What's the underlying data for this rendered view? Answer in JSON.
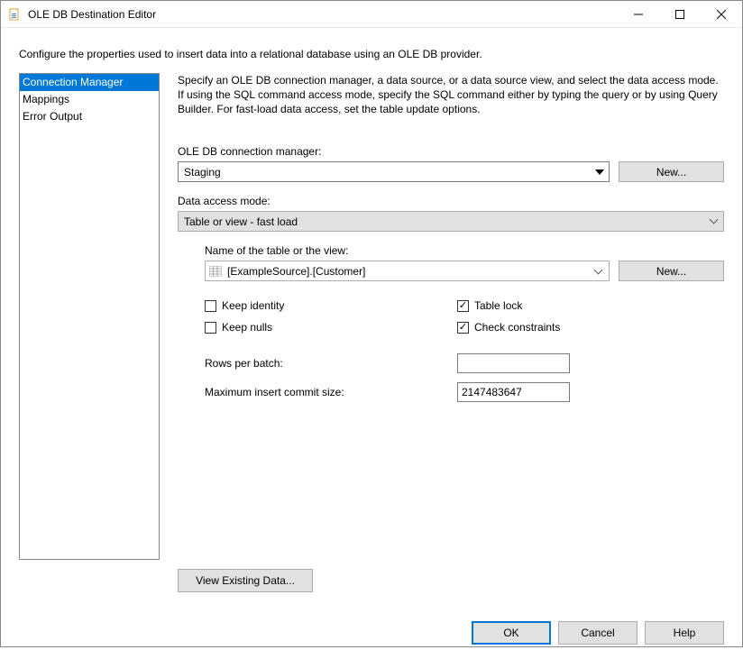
{
  "titlebar": {
    "title": "OLE DB Destination Editor"
  },
  "subtitle": "Configure the properties used to insert data into a relational database using an OLE DB provider.",
  "sidebar": {
    "items": [
      {
        "label": "Connection Manager",
        "selected": true
      },
      {
        "label": "Mappings",
        "selected": false
      },
      {
        "label": "Error Output",
        "selected": false
      }
    ]
  },
  "panel": {
    "description": "Specify an OLE DB connection manager, a data source, or a data source view, and select the data access mode. If using the SQL command access mode, specify the SQL command either by typing the query or by using Query Builder. For fast-load data access, set the table update options.",
    "conn_label": "OLE DB connection manager:",
    "conn_value": "Staging",
    "new1": "New...",
    "mode_label": "Data access mode:",
    "mode_value": "Table or view - fast load",
    "table_label": "Name of the table or the view:",
    "table_value": "[ExampleSource].[Customer]",
    "new2": "New...",
    "chk_keep_identity": "Keep identity",
    "chk_keep_nulls": "Keep nulls",
    "chk_table_lock": "Table lock",
    "chk_check_constraints": "Check constraints",
    "rows_label": "Rows per batch:",
    "rows_value": "",
    "commit_label": "Maximum insert commit size:",
    "commit_value": "2147483647",
    "view_existing": "View Existing Data..."
  },
  "footer": {
    "ok": "OK",
    "cancel": "Cancel",
    "help": "Help"
  }
}
